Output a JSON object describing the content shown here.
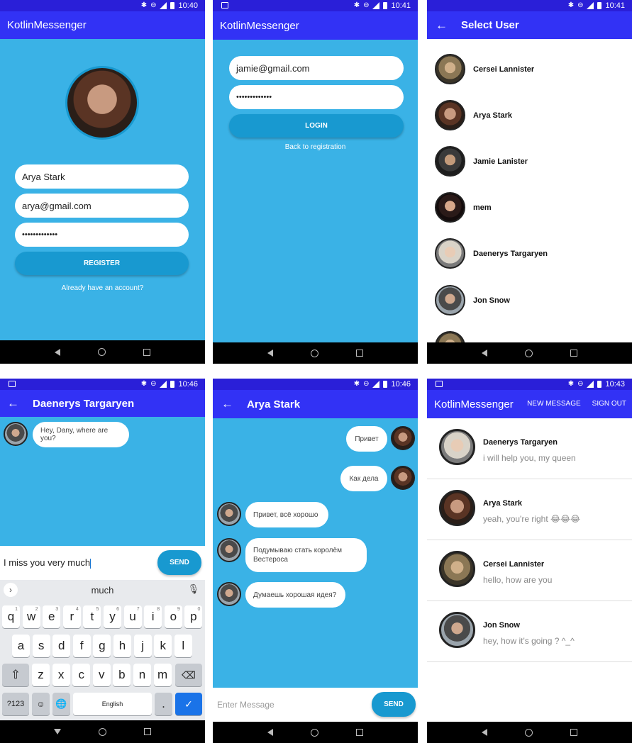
{
  "status_bar": {
    "times": [
      "10:40",
      "10:41",
      "10:41",
      "10:46",
      "10:46",
      "10:43"
    ]
  },
  "register": {
    "app_title": "KotlinMessenger",
    "username": "Arya Stark",
    "email": "arya@gmail.com",
    "password": "•••••••••••••",
    "register_button": "REGISTER",
    "login_link": "Already have an account?"
  },
  "login": {
    "app_title": "KotlinMessenger",
    "email": "jamie@gmail.com",
    "password": "•••••••••••••",
    "login_button": "LOGIN",
    "registration_link": "Back to registration"
  },
  "select_user": {
    "title": "Select User",
    "users": [
      {
        "name": "Cersei Lannister",
        "face": "face-cersei"
      },
      {
        "name": "Arya Stark",
        "face": "face-arya"
      },
      {
        "name": "Jamie Lanister",
        "face": "face-jamie"
      },
      {
        "name": "mem",
        "face": "face-mem"
      },
      {
        "name": "Daenerys Targaryen",
        "face": "face-dany"
      },
      {
        "name": "Jon Snow",
        "face": "face-jon"
      }
    ]
  },
  "chat_dany": {
    "title": "Daenerys Targaryen",
    "messages": [
      {
        "text": "Hey, Dany, where are you?",
        "from": "them"
      }
    ],
    "input_value": "I miss you very much",
    "send_button": "SEND",
    "keyboard": {
      "suggestion": "much",
      "row1": [
        "q",
        "w",
        "e",
        "r",
        "t",
        "y",
        "u",
        "i",
        "o",
        "p"
      ],
      "row1_hints": [
        "1",
        "2",
        "3",
        "4",
        "5",
        "6",
        "7",
        "8",
        "9",
        "0"
      ],
      "row2": [
        "a",
        "s",
        "d",
        "f",
        "g",
        "h",
        "j",
        "k",
        "l"
      ],
      "row3": [
        "z",
        "x",
        "c",
        "v",
        "b",
        "n",
        "m"
      ],
      "symbols_key": "?123",
      "space_label": "English",
      "period_key": "."
    }
  },
  "chat_arya": {
    "title": "Arya Stark",
    "messages": [
      {
        "text": "Привет",
        "from": "me"
      },
      {
        "text": "Как дела",
        "from": "me"
      },
      {
        "text": "Привет, всё хорошо",
        "from": "them"
      },
      {
        "text": "Подумываю стать королём Вестероса",
        "from": "them"
      },
      {
        "text": "Думаешь хорошая идея?",
        "from": "them"
      }
    ],
    "input_placeholder": "Enter Message",
    "send_button": "SEND"
  },
  "latest_messages": {
    "app_title": "KotlinMessenger",
    "actions": {
      "new_message": "NEW MESSAGE",
      "sign_out": "SIGN OUT"
    },
    "rows": [
      {
        "name": "Daenerys Targaryen",
        "message": "i will help you, my queen",
        "face": "face-dany"
      },
      {
        "name": "Arya Stark",
        "message": "yeah, you're right 😂😂😂",
        "face": "face-arya"
      },
      {
        "name": "Cersei Lannister",
        "message": "hello, how are you",
        "face": "face-cersei"
      },
      {
        "name": "Jon Snow",
        "message": "hey, how it's going ? ^_^",
        "face": "face-jon"
      }
    ]
  },
  "colors": {
    "status": "#2a1fd8",
    "appbar": "#3232f5",
    "background": "#3ab2e6",
    "button": "#1899d0"
  }
}
